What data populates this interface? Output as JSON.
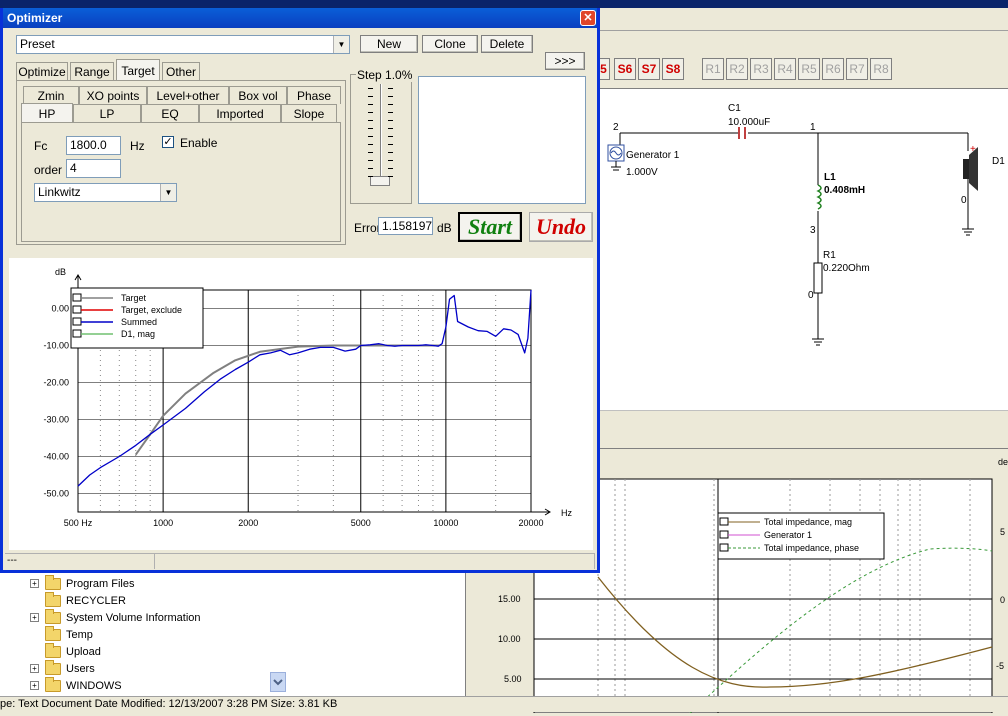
{
  "optimizer": {
    "title": "Optimizer",
    "close_glyph": "✕",
    "preset": {
      "value": "Preset"
    },
    "buttons": {
      "new": "New",
      "clone": "Clone",
      "delete": "Delete",
      "more": ">>>",
      "start": "Start",
      "undo": "Undo"
    },
    "tabs_top": [
      "Optimize",
      "Range",
      "Target",
      "Other"
    ],
    "tabs_row1": [
      "Zmin",
      "XO points",
      "Level+other",
      "Box vol",
      "Phase"
    ],
    "tabs_row2": [
      "HP",
      "LP",
      "EQ",
      "Imported",
      "Slope"
    ],
    "hp": {
      "fc_label": "Fc",
      "fc_value": "1800.0",
      "fc_unit": "Hz",
      "enable_label": "Enable",
      "enable_checked": true,
      "order_label": "order",
      "order_value": "4",
      "type_value": "Linkwitz"
    },
    "step_label": "Step 1.0%",
    "error_label": "Error",
    "error_value": "1.158197",
    "error_unit": "dB",
    "status_text": "---"
  },
  "chart_data": {
    "type": "line",
    "ylabel": "dB",
    "xlabel": "Hz",
    "x_scale": "log",
    "xlim": [
      500,
      20000
    ],
    "ylim": [
      -55,
      5
    ],
    "x_ticks": [
      "500 Hz",
      "1000",
      "2000",
      "5000",
      "10000",
      "20000"
    ],
    "y_ticks": [
      "0.00",
      "-10.00",
      "-20.00",
      "-30.00",
      "-40.00",
      "-50.00"
    ],
    "grid": true,
    "legend_position": "top-left",
    "series": [
      {
        "name": "Target",
        "color": "#808080",
        "x": [
          800,
          900,
          1000,
          1200,
          1500,
          1800,
          2200,
          3000,
          4000,
          5000,
          6000,
          8000,
          9500
        ],
        "y": [
          -39.5,
          -34,
          -29,
          -23,
          -17.5,
          -14,
          -11.7,
          -10.3,
          -10,
          -10,
          -10,
          -10,
          -10
        ]
      },
      {
        "name": "Target, exclude",
        "color": "#e00000",
        "x": [],
        "y": []
      },
      {
        "name": "Summed",
        "color": "#0000c8",
        "x": [
          500,
          550,
          600,
          700,
          800,
          900,
          1000,
          1200,
          1400,
          1600,
          1800,
          2000,
          2200,
          2400,
          2600,
          2800,
          3000,
          3300,
          3600,
          4000,
          4400,
          4800,
          5000,
          5400,
          5800,
          6200,
          6600,
          7000,
          7500,
          8000,
          8500,
          9000,
          9400,
          9700,
          10000,
          10300,
          10700,
          11000,
          12000,
          13000,
          14000,
          15000,
          16000,
          17000,
          18000,
          19000,
          19500,
          20000
        ],
        "y": [
          -48,
          -45,
          -43,
          -40,
          -37,
          -34,
          -31.5,
          -27,
          -22.5,
          -19,
          -16.5,
          -14.5,
          -12.5,
          -12,
          -11.3,
          -12.5,
          -12,
          -11,
          -10.5,
          -10.5,
          -11.5,
          -11,
          -10,
          -9.8,
          -9.5,
          -10,
          -10.2,
          -10,
          -10,
          -10,
          -9.8,
          -10,
          -10.2,
          -9.5,
          -5,
          2.5,
          3.5,
          -3.5,
          -5,
          -6,
          -6.2,
          -7.5,
          -5.5,
          -5.8,
          -7,
          -12,
          -8,
          5
        ]
      },
      {
        "name": "D1, mag",
        "color": "#70c070",
        "x": [],
        "y": []
      }
    ]
  },
  "schematic": {
    "c1_label": "C1",
    "c1_value": "10.000uF",
    "node_2": "2",
    "node_1": "1",
    "generator_label": "Generator 1",
    "generator_value": "1.000V",
    "l1_label": "L1",
    "l1_value": "0.408mH",
    "node_3": "3",
    "r1_label": "R1",
    "r1_value": "0.220Ohm",
    "node_0a": "0",
    "node_0b": "0",
    "d1_label": "D1",
    "d1_plus": "+"
  },
  "s_buttons": [
    "5",
    "S6",
    "S7",
    "S8"
  ],
  "r_buttons": [
    "R1",
    "R2",
    "R3",
    "R4",
    "R5",
    "R6",
    "R7",
    "R8"
  ],
  "impedance_chart": {
    "legend": [
      "Total impedance, mag",
      "Generator 1",
      "Total impedance, phase"
    ],
    "y_ticks": [
      "15.00",
      "10.00",
      "5.00"
    ],
    "right_ticks": [
      "5",
      "0",
      "-5"
    ],
    "corner_label": "de"
  },
  "explorer": {
    "items": [
      {
        "label": "Program Files",
        "expandable": true
      },
      {
        "label": "RECYCLER",
        "expandable": false
      },
      {
        "label": "System Volume Information",
        "expandable": true
      },
      {
        "label": "Temp",
        "expandable": false
      },
      {
        "label": "Upload",
        "expandable": false
      },
      {
        "label": "Users",
        "expandable": true
      },
      {
        "label": "WINDOWS",
        "expandable": true
      }
    ]
  },
  "status_bar": "pe: Text Document Date Modified: 12/13/2007 3:28 PM Size: 3.81 KB"
}
